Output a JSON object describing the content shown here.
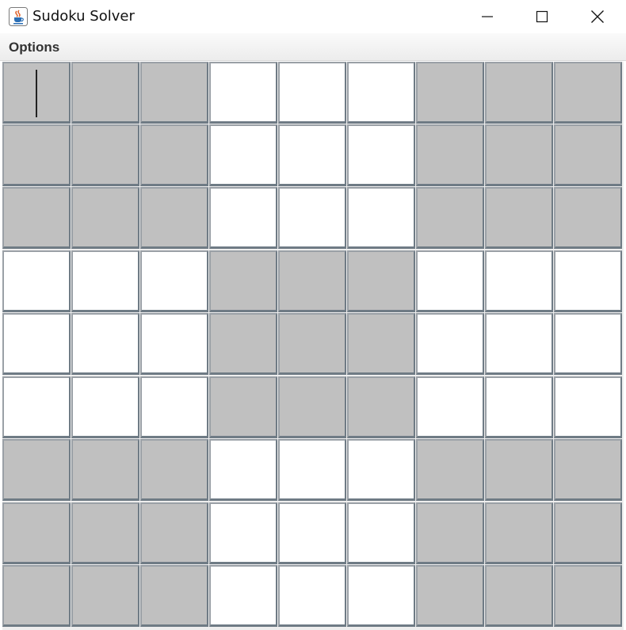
{
  "window": {
    "title": "Sudoku Solver",
    "icon": "java-cup-icon",
    "controls": [
      "minimize-icon",
      "maximize-icon",
      "close-icon"
    ]
  },
  "menu": {
    "items": [
      {
        "label": "Options"
      }
    ]
  },
  "board": {
    "rows": 9,
    "cols": 9,
    "values": [
      [
        "",
        "",
        "",
        "",
        "",
        "",
        "",
        "",
        ""
      ],
      [
        "",
        "",
        "",
        "",
        "",
        "",
        "",
        "",
        ""
      ],
      [
        "",
        "",
        "",
        "",
        "",
        "",
        "",
        "",
        ""
      ],
      [
        "",
        "",
        "",
        "",
        "",
        "",
        "",
        "",
        ""
      ],
      [
        "",
        "",
        "",
        "",
        "",
        "",
        "",
        "",
        ""
      ],
      [
        "",
        "",
        "",
        "",
        "",
        "",
        "",
        "",
        ""
      ],
      [
        "",
        "",
        "",
        "",
        "",
        "",
        "",
        "",
        ""
      ],
      [
        "",
        "",
        "",
        "",
        "",
        "",
        "",
        "",
        ""
      ],
      [
        "",
        "",
        "",
        "",
        "",
        "",
        "",
        "",
        ""
      ]
    ],
    "focused_cell": {
      "row": 0,
      "col": 0
    },
    "colors": {
      "shaded_box": "#c0c0c0",
      "plain_box": "#ffffff"
    }
  }
}
